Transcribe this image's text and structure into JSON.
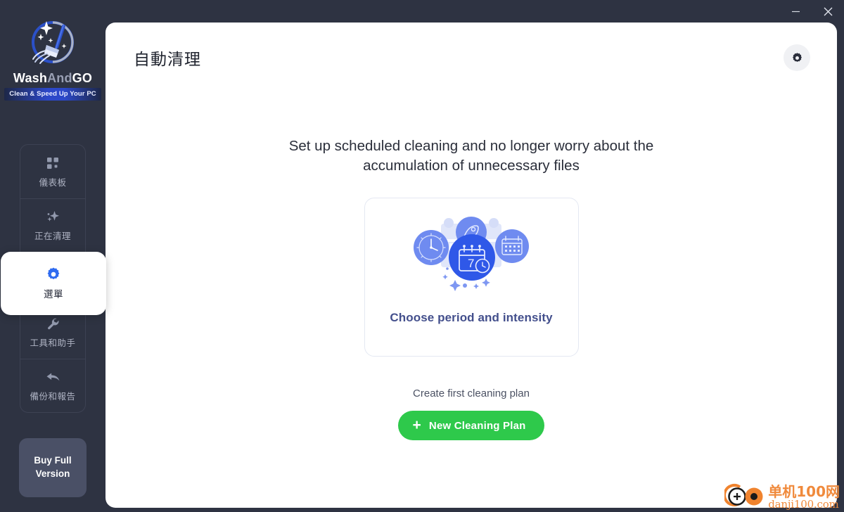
{
  "window": {
    "minimize_label": "—",
    "close_label": "✕",
    "minimize_icon": "minimize-icon",
    "close_icon": "close-icon"
  },
  "brand": {
    "logo_icon": "washandgo-logo-icon",
    "name_part1": "Wash",
    "name_part2": "And",
    "name_part3": "GO",
    "tagline": "Clean & Speed Up Your PC"
  },
  "sidebar": {
    "items": [
      {
        "label": "儀表板",
        "icon": "grid-dashboard-icon",
        "active": false
      },
      {
        "label": "正在清理",
        "icon": "sparkle-icon",
        "active": false
      },
      {
        "label": "選單",
        "icon": "gear-icon",
        "active": true
      },
      {
        "label": "工具和助手",
        "icon": "wrench-icon",
        "active": false
      },
      {
        "label": "備份和報告",
        "icon": "reply-arrow-icon",
        "active": false
      }
    ],
    "buy_button": {
      "line1": "Buy Full",
      "line2": "Version"
    }
  },
  "header": {
    "title": "自動清理",
    "settings_icon": "gear-icon"
  },
  "main": {
    "headline": "Set up scheduled cleaning and no longer worry about the accumulation of unnecessary files",
    "card": {
      "illustration_icon": "schedule-calendar-clock-illustration",
      "label": "Choose period and intensity",
      "calendar_day": "7"
    },
    "subtext": "Create first cleaning plan",
    "cta": {
      "plus_icon": "plus-icon",
      "label": "New Cleaning Plan"
    }
  },
  "watermark": {
    "logo_icon": "danji100-logo-icon",
    "cn": "单机100网",
    "en": "danji100.com"
  },
  "colors": {
    "app_background": "#2e3342",
    "panel_background": "#ffffff",
    "accent_blue": "#2f6bf0",
    "cta_green": "#2ec94b",
    "card_text": "#434f8c",
    "watermark_orange": "#f08a3c"
  }
}
